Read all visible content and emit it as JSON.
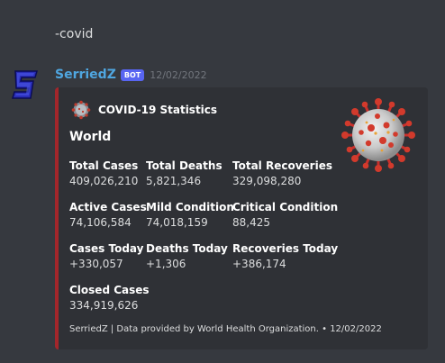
{
  "previous_message": {
    "text": "-covid"
  },
  "message": {
    "username": "SerriedZ",
    "bot_tag": "BOT",
    "timestamp": "12/02/2022",
    "avatar_icon": "s-letter-avatar-icon"
  },
  "embed": {
    "accent_color": "#a3262b",
    "author_name": "COVID-19 Statistics",
    "author_icon": "virus-icon",
    "title": "World",
    "thumbnail_icon": "coronavirus-image",
    "fields": [
      {
        "name": "Total Cases",
        "value": "409,026,210"
      },
      {
        "name": "Total Deaths",
        "value": "5,821,346"
      },
      {
        "name": "Total Recoveries",
        "value": "329,098,280"
      },
      {
        "name": "Active Cases",
        "value": "74,106,584"
      },
      {
        "name": "Mild Condition",
        "value": "74,018,159"
      },
      {
        "name": "Critical Condition",
        "value": "88,425"
      },
      {
        "name": "Cases Today",
        "value": "+330,057"
      },
      {
        "name": "Deaths Today",
        "value": "+1,306"
      },
      {
        "name": "Recoveries Today",
        "value": "+386,174"
      },
      {
        "name": "Closed Cases",
        "value": "334,919,626"
      }
    ],
    "footer": "SerriedZ | Data provided by World Health Organization. • 12/02/2022"
  }
}
